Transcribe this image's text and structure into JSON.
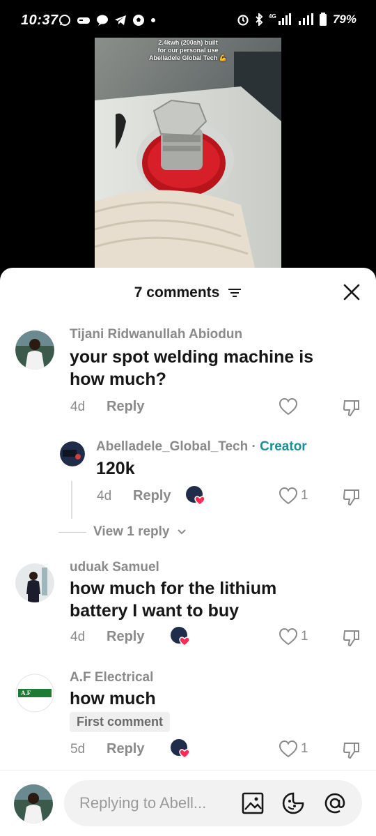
{
  "status_bar": {
    "time": "10:37",
    "battery": "79%",
    "network": "4G"
  },
  "video": {
    "caption_line1": "2.4kwh (200ah) built",
    "caption_line2": "for our personal use",
    "caption_line3": "Abelladele Global Tech 💪"
  },
  "sheet": {
    "title": "7 comments"
  },
  "comments": [
    {
      "author": "Tijani Ridwanullah Abiodun",
      "text_line1": "your spot welding machine is",
      "text_line2": "how much?",
      "age": "4d",
      "reply_label": "Reply"
    },
    {
      "author": "Abelladele_Global_Tech",
      "creator_sep": " · ",
      "creator_label": "Creator",
      "text": "120k",
      "age": "4d",
      "reply_label": "Reply",
      "likes": "1"
    },
    {
      "author": "uduak Samuel",
      "text_line1": "how much for the lithium",
      "text_line2": "battery I want to buy",
      "age": "4d",
      "reply_label": "Reply",
      "likes": "1"
    },
    {
      "author": "A.F Electrical",
      "text": "how much",
      "badge": "First comment",
      "age": "5d",
      "reply_label": "Reply",
      "likes": "1",
      "logo_text": "A.F"
    }
  ],
  "view_replies": "View 1 reply",
  "footer": {
    "placeholder": "Replying to Abell..."
  },
  "colors": {
    "creator": "#1a8f97",
    "like_heart": "#fe2c55"
  }
}
